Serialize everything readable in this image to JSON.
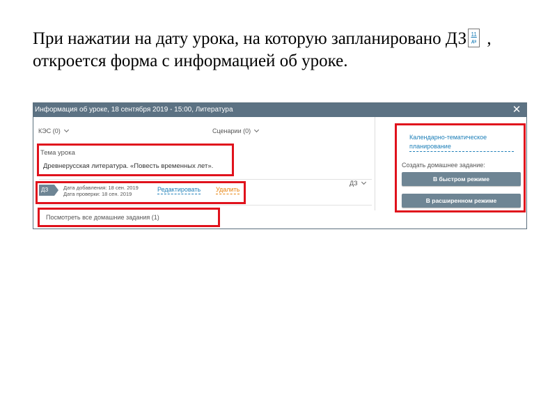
{
  "caption": {
    "line1_prefix": "При нажатии на дату урока, на которую запланировано ДЗ",
    "line1_suffix": " ,",
    "line2": "откроется форма с информацией об уроке.",
    "badge_number": "11",
    "badge_label": "дз"
  },
  "dialog": {
    "title": "Информация об уроке, 18 сентября 2019 - 15:00, Литература",
    "close_glyph": "✕",
    "kes_dropdown": "КЭС (0)",
    "scenarios_dropdown": "Сценарии (0)",
    "hw_dropdown": "ДЗ",
    "theme_label": "Тема урока",
    "theme_value": "Древнерусская литература. «Повесть временных лет».",
    "homework": {
      "tag": "ДЗ",
      "added": "Дата добавления: 18 сен. 2019",
      "checked": "Дата проверки: 18 сен. 2019",
      "edit_link": "Редактировать",
      "delete_link": "Удалить"
    },
    "view_all_homework": "Посмотреть все домашние задания (1)",
    "right_panel": {
      "ktp_link": "Календарно-тематическое планирование",
      "create_label": "Создать домашнее задание:",
      "quick_button": "В быстром режиме",
      "extended_button": "В расширенном режиме"
    }
  },
  "colors": {
    "titlebar": "#5c7283",
    "button": "#6e8594",
    "highlight": "#e0121c",
    "link": "#1d7fb8",
    "delete_link": "#e8820c"
  }
}
